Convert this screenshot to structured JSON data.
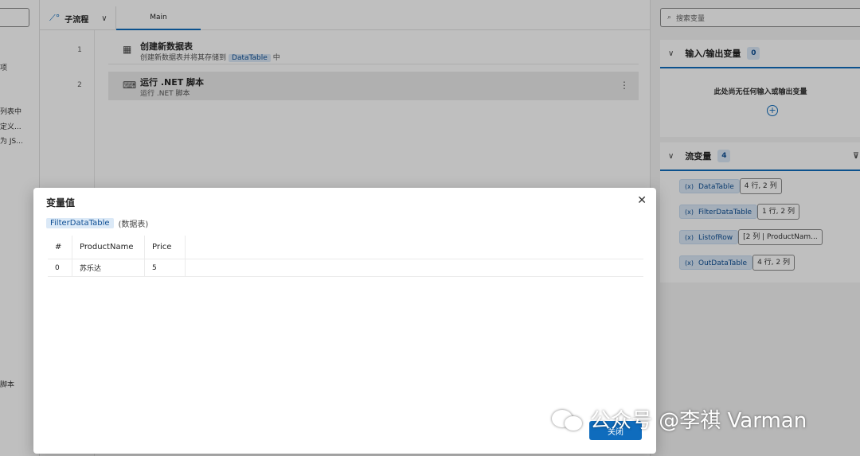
{
  "left_panel": {
    "fragments": [
      "项",
      "列表中",
      "定义...",
      "为 JS...",
      "脚本"
    ]
  },
  "tabs": {
    "subflow_label": "子流程",
    "main_tab": "Main"
  },
  "actions": [
    {
      "line": "1",
      "title": "创建新数据表",
      "desc_before": "创建新数据表并将其存储到",
      "desc_var": "DataTable",
      "desc_after": "中"
    },
    {
      "line": "2",
      "title": "运行 .NET 脚本",
      "desc": "运行 .NET 脚本"
    }
  ],
  "right_panel": {
    "search_placeholder": "搜索变量",
    "io_section": {
      "title": "输入/输出变量",
      "count": "0",
      "empty_text": "此处尚无任何输入或输出变量"
    },
    "flow_section": {
      "title": "流变量",
      "count": "4",
      "vars": [
        {
          "name": "DataTable",
          "info": "4 行, 2 列"
        },
        {
          "name": "FilterDataTable",
          "info": "1 行, 2 列"
        },
        {
          "name": "ListofRow",
          "info": "[2 列 | ProductNam..."
        },
        {
          "name": "OutDataTable",
          "info": "4 行, 2 列"
        }
      ]
    }
  },
  "dialog": {
    "title": "变量值",
    "var_name": "FilterDataTable",
    "var_type": "(数据表)",
    "columns": [
      "#",
      "ProductName",
      "Price"
    ],
    "rows": [
      [
        "0",
        "苏乐达",
        "5"
      ]
    ],
    "ok_label": "关闭"
  },
  "watermark": "公众号 @李祺 Varman",
  "colors": {
    "accent": "#0f6cbd",
    "chip_bg": "#dbe9f7"
  }
}
